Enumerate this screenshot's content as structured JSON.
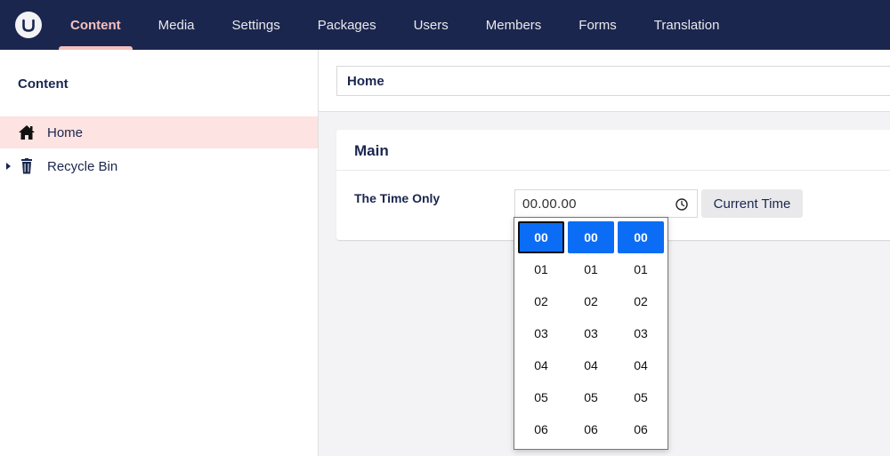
{
  "header": {
    "logo_icon": "umbraco-logo-icon",
    "nav": [
      {
        "label": "Content",
        "active": true
      },
      {
        "label": "Media",
        "active": false
      },
      {
        "label": "Settings",
        "active": false
      },
      {
        "label": "Packages",
        "active": false
      },
      {
        "label": "Users",
        "active": false
      },
      {
        "label": "Members",
        "active": false
      },
      {
        "label": "Forms",
        "active": false
      },
      {
        "label": "Translation",
        "active": false
      }
    ]
  },
  "sidebar": {
    "title": "Content",
    "items": [
      {
        "label": "Home",
        "icon": "home-icon",
        "selected": true
      },
      {
        "label": "Recycle Bin",
        "icon": "trash-icon",
        "selected": false
      }
    ]
  },
  "editor": {
    "node_name": "Home",
    "group_title": "Main",
    "property_label": "The Time Only",
    "time_value": "00.00.00",
    "current_time_button": "Current Time"
  },
  "time_picker": {
    "hours": [
      "00",
      "01",
      "02",
      "03",
      "04",
      "05",
      "06"
    ],
    "minutes": [
      "00",
      "01",
      "02",
      "03",
      "04",
      "05",
      "06"
    ],
    "seconds": [
      "00",
      "01",
      "02",
      "03",
      "04",
      "05",
      "06"
    ],
    "selected": {
      "hours": "00",
      "minutes": "00",
      "seconds": "00"
    }
  },
  "colors": {
    "header_bg": "#1b264f",
    "active_nav": "#f5c1bc",
    "selected_tree_bg": "#fde3e1",
    "picker_selected": "#0b6df5"
  }
}
